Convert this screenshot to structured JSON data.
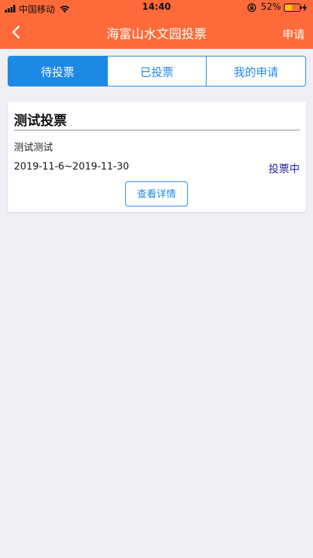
{
  "status_bar": {
    "carrier": "中国移动",
    "time": "14:40",
    "battery_percent": "52%",
    "battery_level": 0.52,
    "battery_color": "#f5c400"
  },
  "header": {
    "title": "海富山水文园投票",
    "back_icon": "chevron-left-icon",
    "action_label": "申请",
    "background_color": "#ff6a3a"
  },
  "tabs": [
    {
      "label": "待投票",
      "active": true
    },
    {
      "label": "已投票",
      "active": false
    },
    {
      "label": "我的申请",
      "active": false
    }
  ],
  "accent_color": "#1e88e5",
  "votes": [
    {
      "title": "测试投票",
      "description": "测试测试",
      "date_range": "2019-11-6~2019-11-30",
      "status": "投票中",
      "detail_button": "查看详情"
    }
  ]
}
